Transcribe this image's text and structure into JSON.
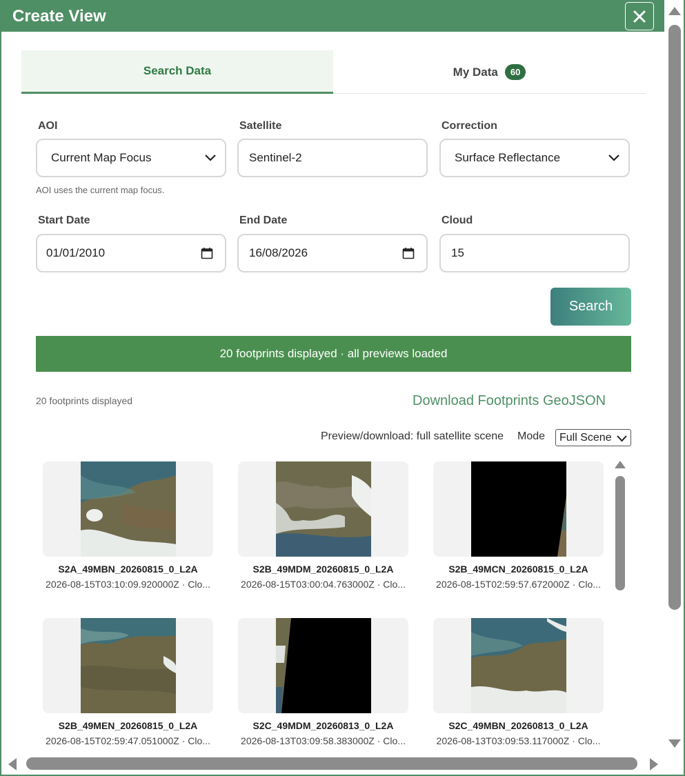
{
  "window": {
    "title": "Create View"
  },
  "tabs": [
    {
      "label": "Search Data"
    },
    {
      "label": "My Data",
      "badge": "60"
    }
  ],
  "form": {
    "aoi": {
      "label": "AOI",
      "value": "Current Map Focus",
      "hint": "AOI uses the current map focus."
    },
    "satellite": {
      "label": "Satellite",
      "value": "Sentinel-2"
    },
    "correction": {
      "label": "Correction",
      "value": "Surface Reflectance"
    },
    "start_date": {
      "label": "Start Date",
      "value": "01/01/2010"
    },
    "end_date": {
      "label": "End Date",
      "value": "16/08/2026"
    },
    "cloud": {
      "label": "Cloud",
      "value": "15"
    },
    "search_label": "Search"
  },
  "status": {
    "message": "20 footprints displayed · all previews loaded"
  },
  "results": {
    "count_text": "20 footprints displayed",
    "download_link": "Download Footprints GeoJSON",
    "preview_text": "Preview/download: full satellite scene",
    "mode_label": "Mode",
    "mode_value": "Full Scene",
    "items": [
      {
        "name": "S2A_49MBN_20260815_0_L2A",
        "meta": "2026-08-15T03:10:09.920000Z · Clo..."
      },
      {
        "name": "S2B_49MDM_20260815_0_L2A",
        "meta": "2026-08-15T03:00:04.763000Z · Clo..."
      },
      {
        "name": "S2B_49MCN_20260815_0_L2A",
        "meta": "2026-08-15T02:59:57.672000Z · Clo..."
      },
      {
        "name": "S2B_49MEN_20260815_0_L2A",
        "meta": "2026-08-15T02:59:47.051000Z · Clo..."
      },
      {
        "name": "S2C_49MDM_20260813_0_L2A",
        "meta": "2026-08-13T03:09:58.383000Z · Clo..."
      },
      {
        "name": "S2C_49MBN_20260813_0_L2A",
        "meta": "2026-08-13T03:09:53.117000Z · Clo..."
      }
    ]
  },
  "colors": {
    "brand": "#4f8f66",
    "status_bar": "#4a8f4f",
    "badge": "#2f6e42"
  }
}
